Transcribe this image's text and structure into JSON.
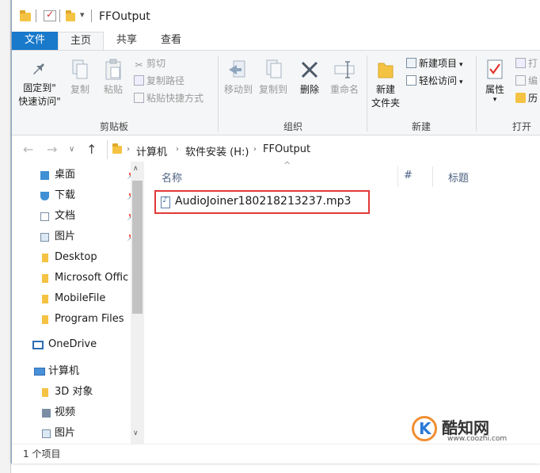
{
  "window": {
    "title": "FFOutput"
  },
  "tabs": {
    "file": "文件",
    "home": "主页",
    "share": "共享",
    "view": "查看"
  },
  "ribbon": {
    "clipboard": {
      "pin": "固定到\"\n快速访问\"",
      "pin_line1": "固定到\"",
      "pin_line2": "快速访问\"",
      "copy": "复制",
      "paste": "粘贴",
      "cut": "剪切",
      "copy_path": "复制路径",
      "paste_shortcut": "粘贴快捷方式",
      "label": "剪贴板"
    },
    "organize": {
      "move_to": "移动到",
      "copy_to": "复制到",
      "delete": "删除",
      "rename": "重命名",
      "label": "组织"
    },
    "new": {
      "new_folder_line1": "新建",
      "new_folder_line2": "文件夹",
      "new_item": "新建项目",
      "easy_access": "轻松访问",
      "label": "新建"
    },
    "open": {
      "properties": "属性",
      "open_partial": "打",
      "edit_partial": "编",
      "history_partial": "历",
      "label": "打开"
    }
  },
  "address": {
    "crumbs": [
      "计算机",
      "软件安装 (H:)",
      "FFOutput"
    ]
  },
  "nav": {
    "items": [
      {
        "label": "桌面",
        "pinned": true
      },
      {
        "label": "下载",
        "pinned": true
      },
      {
        "label": "文档",
        "pinned": true
      },
      {
        "label": "图片",
        "pinned": true
      },
      {
        "label": "Desktop"
      },
      {
        "label": "Microsoft Offic"
      },
      {
        "label": "MobileFile"
      },
      {
        "label": "Program Files"
      },
      {
        "label": "OneDrive"
      },
      {
        "label": "计算机"
      },
      {
        "label": "3D 对象"
      },
      {
        "label": "视频"
      },
      {
        "label": "图片"
      }
    ]
  },
  "columns": {
    "name": "名称",
    "number": "#",
    "title": "标题"
  },
  "files": [
    {
      "name": "AudioJoiner180218213237.mp3"
    }
  ],
  "status": {
    "count": "1 个项目"
  },
  "watermark": {
    "name": "酷知网",
    "url": "www.coozhi.com"
  },
  "colors": {
    "accent": "#1979ca",
    "highlight": "#e23838",
    "folder": "#f5c343"
  }
}
